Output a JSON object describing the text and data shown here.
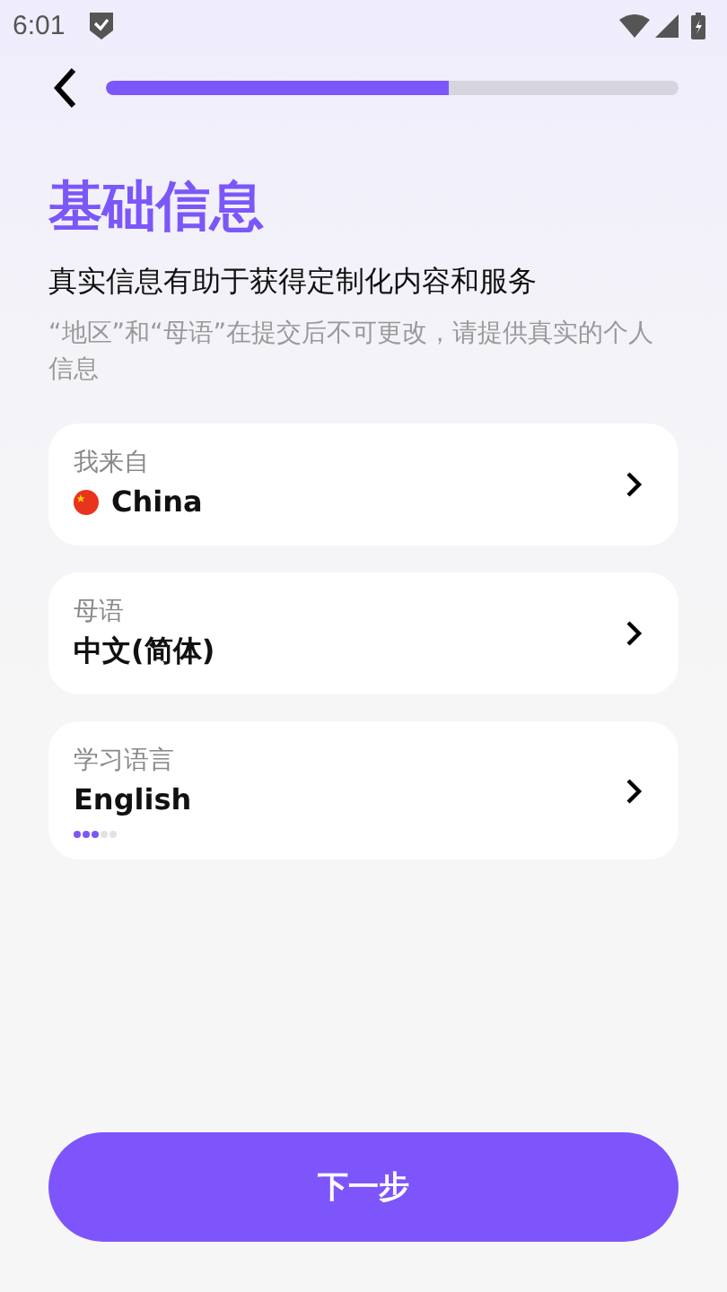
{
  "status_bar": {
    "time": "6:01"
  },
  "header": {
    "progress": {
      "level": 0.6
    }
  },
  "title": "基础信息",
  "subtitle": "真实信息有助于获得定制化内容和服务",
  "note": "“地区”和“母语”在提交后不可更改，请提供真实的个人信息",
  "fields": [
    {
      "kind": "country",
      "label": "我来自",
      "value": "China"
    },
    {
      "kind": "plain",
      "label": "母语",
      "value": "中文(简体)"
    },
    {
      "kind": "level",
      "label": "学习语言",
      "value": "English",
      "stars": 3
    }
  ],
  "next_button": "下一步"
}
